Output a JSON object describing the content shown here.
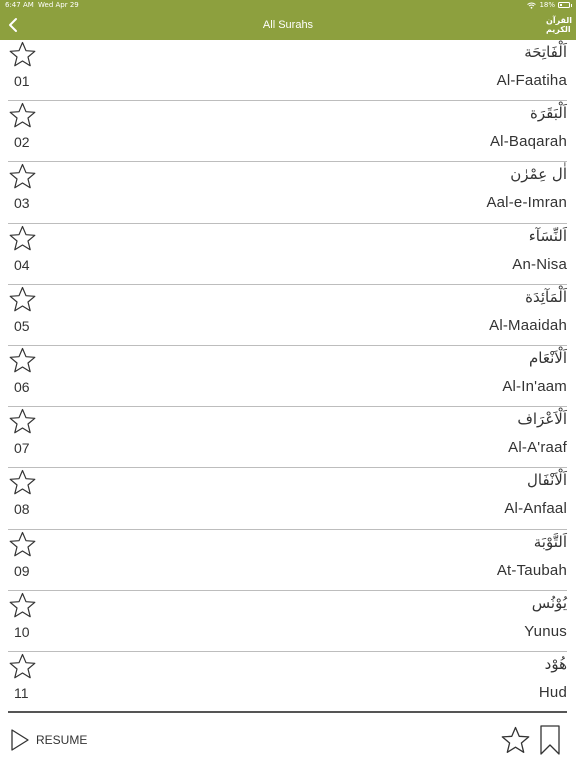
{
  "status_bar": {
    "time": "6:47 AM",
    "date": "Wed Apr 29",
    "battery": "18%"
  },
  "nav": {
    "back_icon": "chevron-left-icon",
    "title": "All Surahs",
    "logo_line1": "القرآن",
    "logo_line2": "الكريم"
  },
  "surahs": [
    {
      "arabic": "اَلْفَاتِحَة",
      "number": "01",
      "name": "Al-Faatiha"
    },
    {
      "arabic": "اَلْبَقَرَة",
      "number": "02",
      "name": "Al-Baqarah"
    },
    {
      "arabic": "اٰل عِمْرٰن",
      "number": "03",
      "name": "Aal-e-Imran"
    },
    {
      "arabic": "اَلنِّسَآء",
      "number": "04",
      "name": "An-Nisa"
    },
    {
      "arabic": "اَلْمَآئِدَة",
      "number": "05",
      "name": "Al-Maaidah"
    },
    {
      "arabic": "اَلْاَنْعَام",
      "number": "06",
      "name": "Al-In'aam"
    },
    {
      "arabic": "اَلْاَعْرَاف",
      "number": "07",
      "name": "Al-A'raaf"
    },
    {
      "arabic": "اَلْاَنْفَال",
      "number": "08",
      "name": "Al-Anfaal"
    },
    {
      "arabic": "اَلتَّوْبَة",
      "number": "09",
      "name": "At-Taubah"
    },
    {
      "arabic": "يُوْنُس",
      "number": "10",
      "name": "Yunus"
    },
    {
      "arabic": "هُوْد",
      "number": "11",
      "name": "Hud"
    }
  ],
  "footer": {
    "resume_label": "RESUME",
    "resume_icon": "play-icon",
    "favorites_icon": "star-icon",
    "bookmarks_icon": "bookmark-icon"
  },
  "colors": {
    "accent": "#8da03e"
  }
}
